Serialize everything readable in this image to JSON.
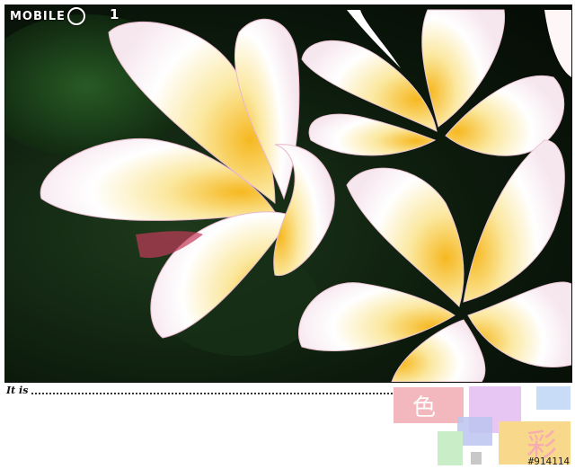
{
  "header": {
    "logo_text": "MOBILE",
    "logo_suffix": "1"
  },
  "photo": {
    "subject_icon": "flower-photo"
  },
  "caption": {
    "label": "It is"
  },
  "decor": {
    "glyph_color": "色",
    "glyph_vivid": "彩",
    "swatch_colors": [
      "#f2b8bd",
      "#e8c6f4",
      "#c8dcf8",
      "#bcc4f0",
      "#c9eec7",
      "#f8d98c",
      "#c8c8c8"
    ]
  },
  "footer": {
    "photo_id": "#914114"
  }
}
